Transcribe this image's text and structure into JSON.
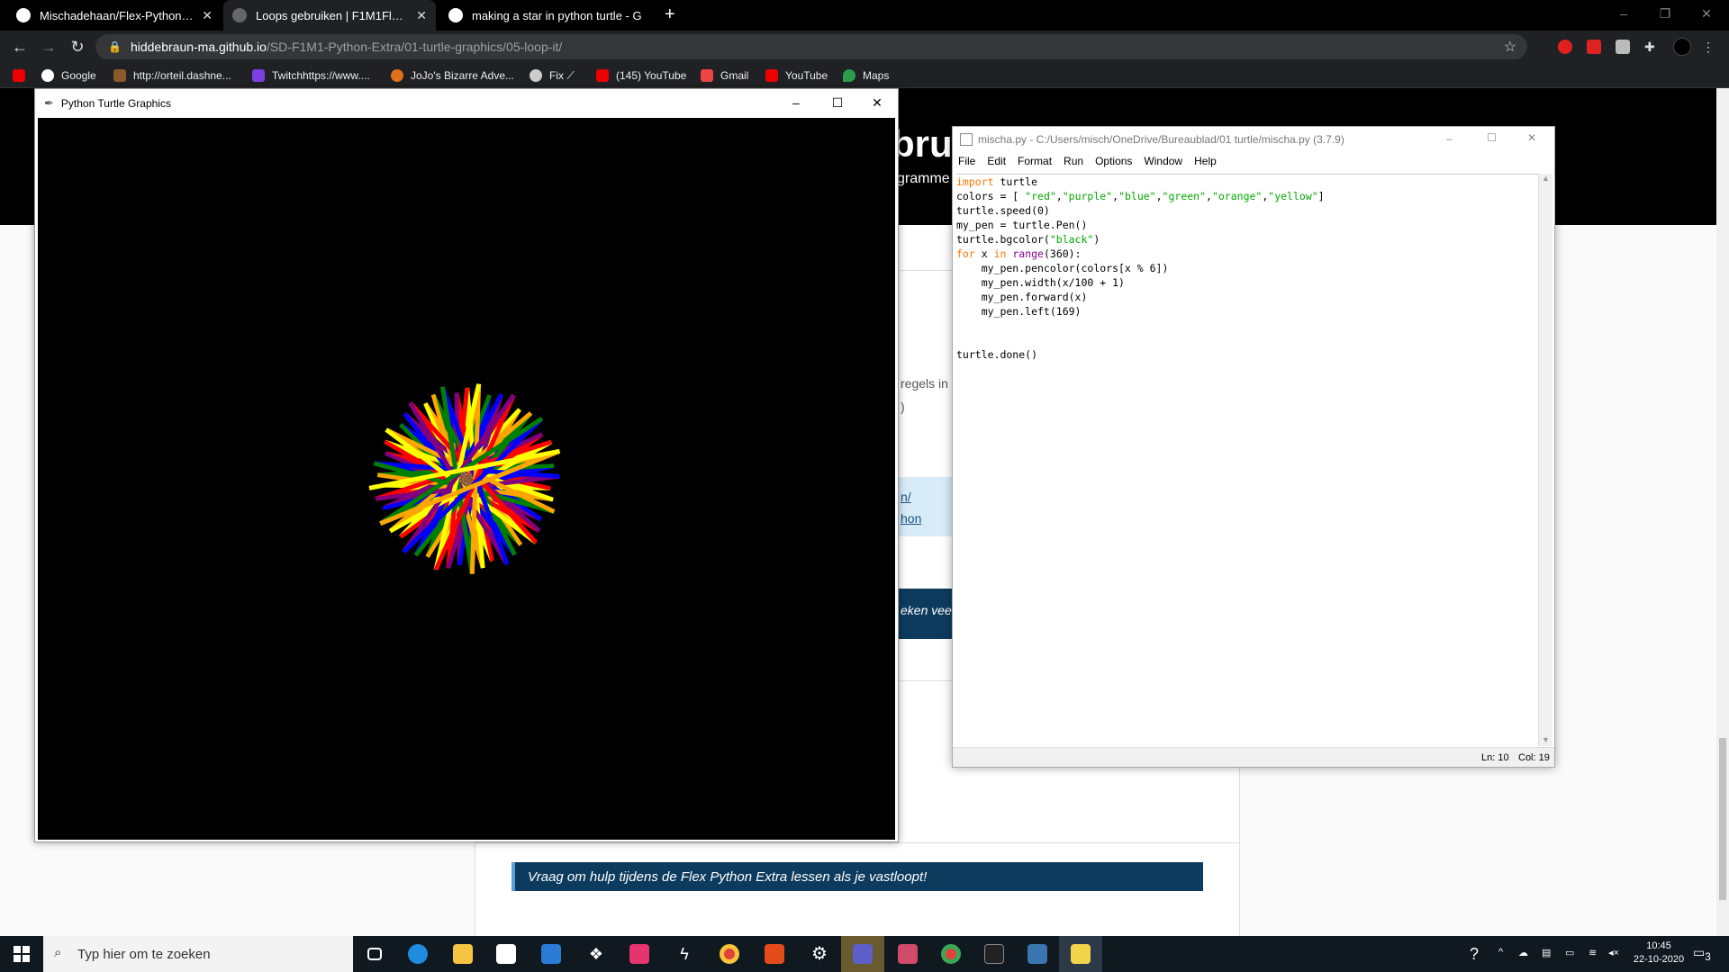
{
  "browser": {
    "tabs": [
      {
        "title": "Mischadehaan/Flex-PythonExtra",
        "active": false
      },
      {
        "title": "Loops gebruiken | F1M1Flex - Py",
        "active": true
      },
      {
        "title": "making a star in python turtle - G",
        "active": false
      }
    ],
    "url_host": "hiddebraun-ma.github.io",
    "url_path": "/SD-F1M1-Python-Extra/01-turtle-graphics/05-loop-it/",
    "bookmarks": [
      "Google",
      "http://orteil.dashne...",
      "Twitchhttps://www....",
      "JoJo's Bizarre Adve...",
      "Fix ⟋",
      "(145) YouTube",
      "Gmail",
      "YouTube",
      "Maps"
    ]
  },
  "page": {
    "hero_fragment_1": "brui",
    "hero_fragment_2": "gramme",
    "fragment_regels": "regels in",
    "fragment_paren": ")",
    "fragment_link1": "n/",
    "fragment_link2": "hon",
    "fragment_veel": "eken vee",
    "help_banner": "Vraag om hulp tijdens de Flex Python Extra lessen als je vastloopt!"
  },
  "turtle_window": {
    "title": "Python Turtle Graphics",
    "pen_colors": [
      "red",
      "purple",
      "blue",
      "green",
      "orange",
      "yellow"
    ],
    "turn_angle": 169,
    "iterations": 360
  },
  "idle": {
    "title": "mischa.py - C:/Users/misch/OneDrive/Bureaublad/01 turtle/mischa.py (3.7.9)",
    "menu": [
      "File",
      "Edit",
      "Format",
      "Run",
      "Options",
      "Window",
      "Help"
    ],
    "status_line": "Ln: 10",
    "status_col": "Col: 19"
  },
  "taskbar": {
    "search_placeholder": "Typ hier om te zoeken",
    "time": "10:45",
    "date": "22-10-2020",
    "notification_count": "3"
  },
  "colors": {
    "accent_banner": "#0d3b5e",
    "idle_keyword": "#ff7700",
    "idle_string": "#00aa00",
    "idle_builtin": "#900090"
  }
}
